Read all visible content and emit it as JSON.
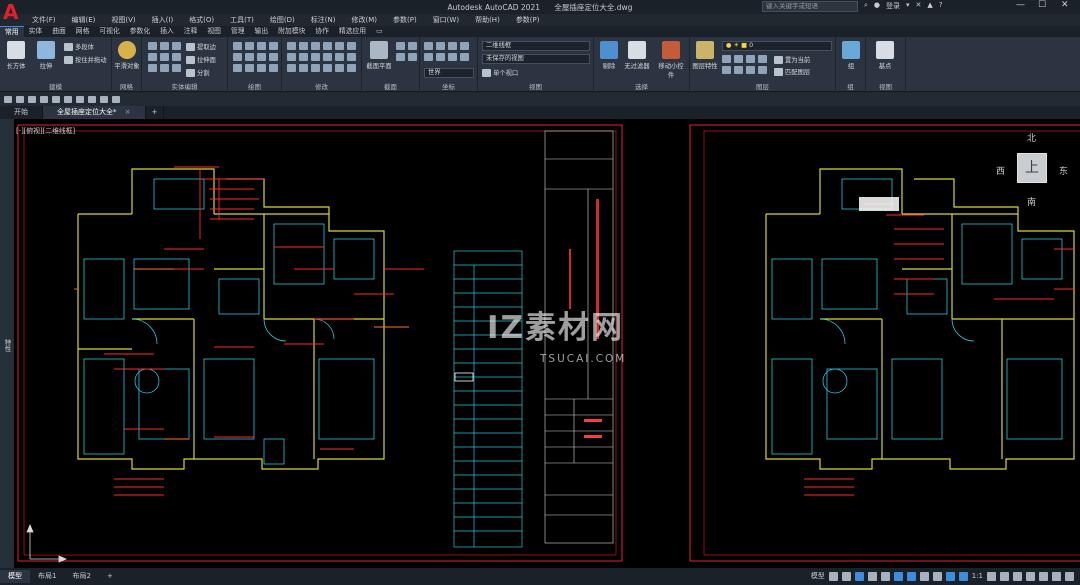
{
  "app": {
    "logo": "A",
    "name": "Autodesk AutoCAD 2021",
    "filename": "全屋插座定位大全.dwg",
    "search_placeholder": "键入关键字或短语",
    "user": "登录",
    "help": "?"
  },
  "menu": [
    "文件(F)",
    "编辑(E)",
    "视图(V)",
    "插入(I)",
    "格式(O)",
    "工具(T)",
    "绘图(D)",
    "标注(N)",
    "修改(M)",
    "参数(P)",
    "窗口(W)",
    "帮助(H)",
    "参数(P)"
  ],
  "ribbon_tabs": [
    "常用",
    "实体",
    "曲面",
    "网格",
    "可视化",
    "参数化",
    "插入",
    "注释",
    "视图",
    "管理",
    "输出",
    "附加模块",
    "协作",
    "精选应用"
  ],
  "ribbon": {
    "modeling": {
      "label": "建模",
      "box": "长方体",
      "extrude": "拉伸",
      "polysolid": "多段体",
      "press_pull": "按住并拖动"
    },
    "mesh": {
      "label": "网格",
      "smooth": "平滑对象"
    },
    "solid_edit": {
      "label": "实体编辑",
      "extract_edges": "提取边",
      "extrude_faces": "拉伸面",
      "separate": "分割"
    },
    "draw": {
      "label": "绘图"
    },
    "modify": {
      "label": "修改"
    },
    "section": {
      "label": "截面",
      "section_plane": "截面平面"
    },
    "coordinates": {
      "label": "坐标",
      "ucs": "世界"
    },
    "view": {
      "label": "视图",
      "visual_style": "二维线框",
      "saved_view": "未保存的视图",
      "viewport": "单个视口"
    },
    "selection": {
      "label": "选择",
      "cull": "剔除",
      "no_filter": "无过滤器",
      "gizmo": "移动小控件"
    },
    "layers": {
      "label": "图层",
      "layer_props": "图层特性",
      "current_layer": "0",
      "set_current": "置为当前",
      "match_layer": "匹配图层"
    },
    "groups": {
      "label": "组",
      "group": "组"
    },
    "view2": {
      "label": "视图",
      "base": "基点"
    }
  },
  "file_tabs": [
    {
      "label": "开始",
      "active": false
    },
    {
      "label": "全屋插座定位大全*",
      "active": true
    }
  ],
  "file_tab_close": "×",
  "file_tab_add": "+",
  "viewport_label": "[-][俯视][二维线框]",
  "side_palette": "特性",
  "viewcube": {
    "north": "北",
    "south": "南",
    "east": "东",
    "west": "西",
    "face": "上"
  },
  "watermark": {
    "main": "IZ素材网",
    "sub": "TSUCAI.COM"
  },
  "layout_tabs": [
    {
      "label": "模型",
      "active": true
    },
    {
      "label": "布局1",
      "active": false
    },
    {
      "label": "布局2",
      "active": false
    }
  ],
  "layout_add": "+",
  "status": {
    "model_label": "模型",
    "scale": "1:1"
  },
  "colors": {
    "accent": "#3c8de0",
    "canvas": "#000000",
    "logo": "#e2202b",
    "frame_red": "#e8222c",
    "plan_yellow": "#d6d92a",
    "plan_cyan": "#27c6d8",
    "plan_red": "#ff2a2a",
    "plan_orange": "#ff7a1a"
  }
}
